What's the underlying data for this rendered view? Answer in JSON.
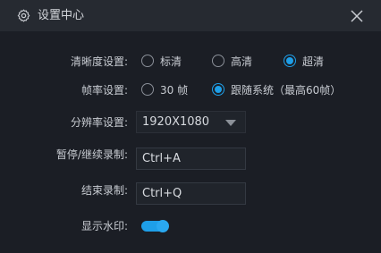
{
  "window": {
    "title": "设置中心",
    "title_icon": "gear-icon",
    "close_icon": "close-icon"
  },
  "settings": {
    "clarity": {
      "label": "清晰度设置:",
      "options": [
        {
          "label": "标清",
          "selected": false
        },
        {
          "label": "高清",
          "selected": false
        },
        {
          "label": "超清",
          "selected": true
        }
      ]
    },
    "framerate": {
      "label": "帧率设置:",
      "options": [
        {
          "label": "30 帧",
          "selected": false
        },
        {
          "label": "跟随系统（最高60帧）",
          "selected": true
        }
      ]
    },
    "resolution": {
      "label": "分辨率设置:",
      "value": "1920X1080"
    },
    "pause_hotkey": {
      "label": "暂停/继续录制:",
      "value": "Ctrl+A"
    },
    "stop_hotkey": {
      "label": "结束录制:",
      "value": "Ctrl+Q"
    },
    "watermark": {
      "label": "显示水印:",
      "enabled": true
    }
  },
  "colors": {
    "accent": "#1e9fe8",
    "background": "#1b1e25",
    "titlebar": "#262a31"
  }
}
